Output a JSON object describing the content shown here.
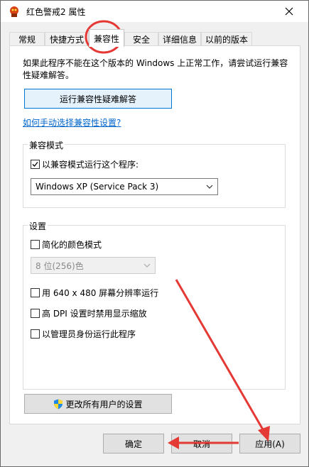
{
  "window": {
    "title": "红色警戒2 属性"
  },
  "tabs": [
    {
      "label": "常规"
    },
    {
      "label": "快捷方式"
    },
    {
      "label": "兼容性"
    },
    {
      "label": "安全"
    },
    {
      "label": "详细信息"
    },
    {
      "label": "以前的版本"
    }
  ],
  "compat": {
    "intro": "如果此程序不能在这个版本的 Windows 上正常工作，请尝试运行兼容性疑难解答。",
    "troubleshoot_button": "运行兼容性疑难解答",
    "manual_link": "如何手动选择兼容性设置?",
    "mode_group_title": "兼容模式",
    "mode_checkbox_label": "以兼容模式运行这个程序:",
    "mode_checked": true,
    "mode_select_value": "Windows XP (Service Pack 3)"
  },
  "settings": {
    "group_title": "设置",
    "reduced_color_label": "简化的颜色模式",
    "color_select_value": "8 位(256)色",
    "res_640_label": "用 640 x 480 屏幕分辨率运行",
    "dpi_label": "高 DPI 设置时禁用显示缩放",
    "admin_label": "以管理员身份运行此程序"
  },
  "change_all_users_button": "更改所有用户的设置",
  "buttons": {
    "ok": "确定",
    "cancel": "取消",
    "apply": "应用(A)"
  },
  "colors": {
    "annotation": "#e53935",
    "link": "#0066cc",
    "focus": "#0078d7"
  },
  "icons": [
    "app-icon",
    "close-icon",
    "shield-icon",
    "chevron-down-icon",
    "check-icon"
  ]
}
